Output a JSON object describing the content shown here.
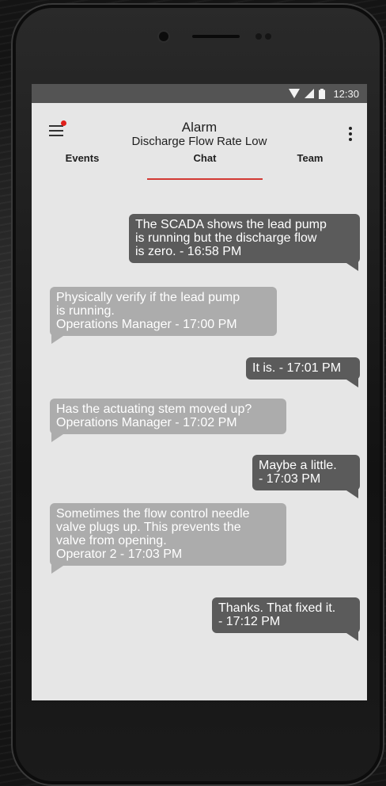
{
  "status_bar": {
    "time": "12:30"
  },
  "header": {
    "title": "Alarm",
    "subtitle": "Discharge Flow Rate Low"
  },
  "tabs": [
    {
      "label": "Events"
    },
    {
      "label": "Chat",
      "active": true
    },
    {
      "label": "Team"
    }
  ],
  "messages": [
    {
      "direction": "sent",
      "lines": [
        "The SCADA shows the lead pump",
        "is running but the discharge flow",
        "is zero. - 16:58 PM"
      ]
    },
    {
      "direction": "received",
      "lines": [
        "Physically verify if the lead pump",
        "is running.",
        "Operations Manager - 17:00 PM"
      ]
    },
    {
      "direction": "sent",
      "lines": [
        "It is. - 17:01 PM"
      ]
    },
    {
      "direction": "received",
      "lines": [
        "Has the actuating stem moved up?",
        "Operations Manager - 17:02 PM"
      ]
    },
    {
      "direction": "sent",
      "lines": [
        "Maybe a little.",
        "- 17:03 PM"
      ]
    },
    {
      "direction": "received",
      "lines": [
        "Sometimes the flow control needle",
        "valve plugs up. This prevents the",
        "valve from opening.",
        "Operator 2 - 17:03 PM"
      ]
    },
    {
      "direction": "sent",
      "lines": [
        "Thanks. That fixed it.",
        "- 17:12 PM"
      ]
    }
  ],
  "colors": {
    "sent_bubble": "#5b5b5b",
    "received_bubble": "#acacac",
    "accent": "#d23a34",
    "notification_dot": "#e0201b",
    "screen_background": "#e6e6e6"
  },
  "icons": {
    "menu": "hamburger-icon",
    "more": "more-vertical-icon",
    "wifi": "wifi-icon",
    "cell": "cell-signal-icon",
    "battery": "battery-icon"
  }
}
